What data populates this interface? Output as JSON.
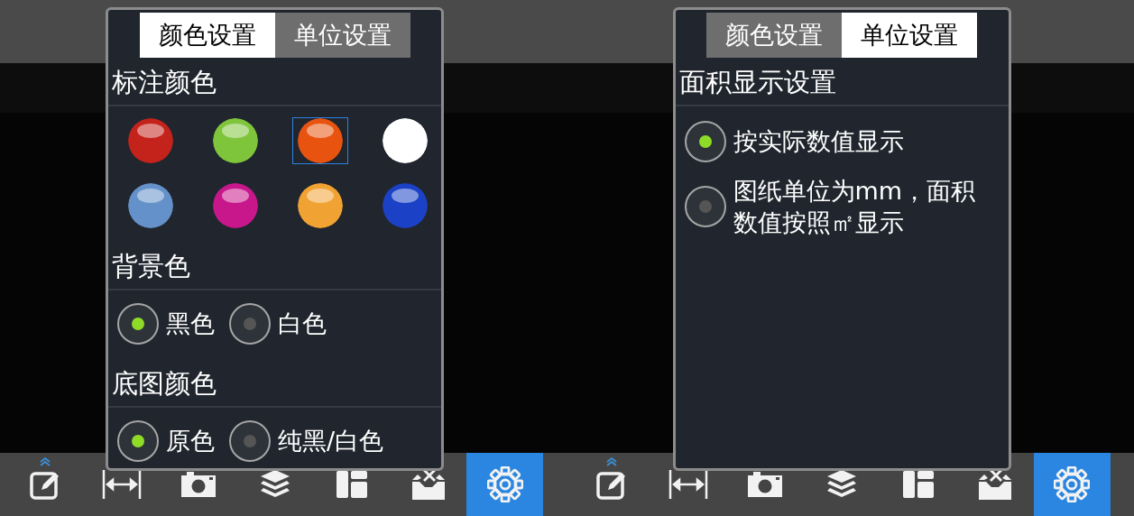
{
  "screens": [
    {
      "dialog": {
        "tabs": [
          {
            "label": "颜色设置",
            "selected": true
          },
          {
            "label": "单位设置",
            "selected": false
          }
        ],
        "sections": [
          {
            "kind": "colors",
            "title": "标注颜色",
            "colors": [
              {
                "color": "#c4231b",
                "selected": false
              },
              {
                "color": "#7fc53c",
                "selected": false
              },
              {
                "color": "#e8540f",
                "selected": true
              },
              {
                "color": "#ffffff",
                "selected": false
              },
              {
                "color": "#6491c9",
                "selected": false
              },
              {
                "color": "#c8178b",
                "selected": false
              },
              {
                "color": "#f0a232",
                "selected": false
              },
              {
                "color": "#1b42c6",
                "selected": false
              }
            ]
          },
          {
            "kind": "radio-row",
            "title": "背景色",
            "options": [
              {
                "label": "黑色",
                "selected": true
              },
              {
                "label": "白色",
                "selected": false
              }
            ]
          },
          {
            "kind": "radio-row",
            "title": "底图颜色",
            "options": [
              {
                "label": "原色",
                "selected": true
              },
              {
                "label": "纯黑/白色",
                "selected": false
              }
            ]
          }
        ]
      },
      "toolbar": [
        {
          "kind": "edit",
          "selected": false
        },
        {
          "kind": "measure",
          "selected": false
        },
        {
          "kind": "camera",
          "selected": false
        },
        {
          "kind": "layers",
          "selected": false
        },
        {
          "kind": "layout",
          "selected": false
        },
        {
          "kind": "toolbox",
          "selected": false
        },
        {
          "kind": "settings",
          "selected": true
        }
      ]
    },
    {
      "dialog": {
        "tabs": [
          {
            "label": "颜色设置",
            "selected": false
          },
          {
            "label": "单位设置",
            "selected": true
          }
        ],
        "sections": [
          {
            "kind": "radio-list",
            "title": "面积显示设置",
            "options": [
              {
                "label": "按实际数值显示",
                "selected": true
              },
              {
                "label": "图纸单位为mm，面积数值按照㎡显示",
                "selected": false
              }
            ]
          }
        ]
      },
      "toolbar": [
        {
          "kind": "edit",
          "selected": false
        },
        {
          "kind": "measure",
          "selected": false
        },
        {
          "kind": "camera",
          "selected": false
        },
        {
          "kind": "layers",
          "selected": false
        },
        {
          "kind": "layout",
          "selected": false
        },
        {
          "kind": "toolbox",
          "selected": false
        },
        {
          "kind": "settings",
          "selected": true
        }
      ]
    }
  ]
}
